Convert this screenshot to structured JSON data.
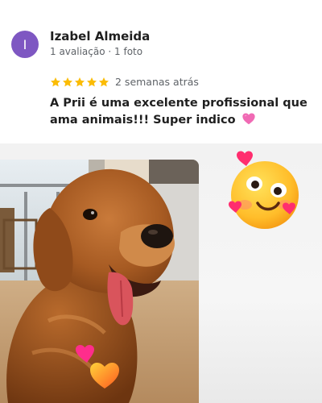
{
  "review": {
    "avatar_letter": "I",
    "author": "Izabel Almeida",
    "meta": "1 avaliação · 1 foto",
    "rating": 5,
    "rating_max": 5,
    "time_ago": "2 semanas atrás",
    "text": "A Prii é uma excelente profissional que ama animais!!! Super indico",
    "text_emoji": "pink-heart-icon"
  },
  "colors": {
    "avatar_bg": "#7e57c2",
    "star": "#fbbc04",
    "text_primary": "#1f1f1f",
    "text_secondary": "#5f6368"
  },
  "media": {
    "photo": "golden-retriever-photo",
    "sticker": "smiling-face-with-hearts-sticker",
    "photo_overlay": "hearts-icon"
  }
}
